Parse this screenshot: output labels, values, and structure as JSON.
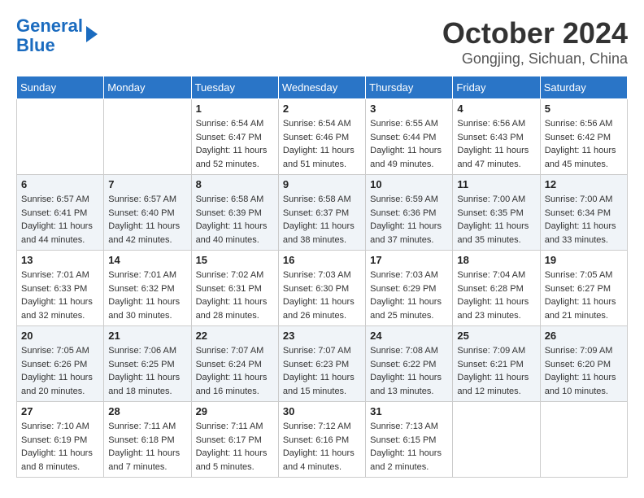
{
  "logo": {
    "line1": "General",
    "line2": "Blue"
  },
  "title": "October 2024",
  "location": "Gongjing, Sichuan, China",
  "days_of_week": [
    "Sunday",
    "Monday",
    "Tuesday",
    "Wednesday",
    "Thursday",
    "Friday",
    "Saturday"
  ],
  "weeks": [
    [
      {
        "day": "",
        "sunrise": "",
        "sunset": "",
        "daylight": ""
      },
      {
        "day": "",
        "sunrise": "",
        "sunset": "",
        "daylight": ""
      },
      {
        "day": "1",
        "sunrise": "Sunrise: 6:54 AM",
        "sunset": "Sunset: 6:47 PM",
        "daylight": "Daylight: 11 hours and 52 minutes."
      },
      {
        "day": "2",
        "sunrise": "Sunrise: 6:54 AM",
        "sunset": "Sunset: 6:46 PM",
        "daylight": "Daylight: 11 hours and 51 minutes."
      },
      {
        "day": "3",
        "sunrise": "Sunrise: 6:55 AM",
        "sunset": "Sunset: 6:44 PM",
        "daylight": "Daylight: 11 hours and 49 minutes."
      },
      {
        "day": "4",
        "sunrise": "Sunrise: 6:56 AM",
        "sunset": "Sunset: 6:43 PM",
        "daylight": "Daylight: 11 hours and 47 minutes."
      },
      {
        "day": "5",
        "sunrise": "Sunrise: 6:56 AM",
        "sunset": "Sunset: 6:42 PM",
        "daylight": "Daylight: 11 hours and 45 minutes."
      }
    ],
    [
      {
        "day": "6",
        "sunrise": "Sunrise: 6:57 AM",
        "sunset": "Sunset: 6:41 PM",
        "daylight": "Daylight: 11 hours and 44 minutes."
      },
      {
        "day": "7",
        "sunrise": "Sunrise: 6:57 AM",
        "sunset": "Sunset: 6:40 PM",
        "daylight": "Daylight: 11 hours and 42 minutes."
      },
      {
        "day": "8",
        "sunrise": "Sunrise: 6:58 AM",
        "sunset": "Sunset: 6:39 PM",
        "daylight": "Daylight: 11 hours and 40 minutes."
      },
      {
        "day": "9",
        "sunrise": "Sunrise: 6:58 AM",
        "sunset": "Sunset: 6:37 PM",
        "daylight": "Daylight: 11 hours and 38 minutes."
      },
      {
        "day": "10",
        "sunrise": "Sunrise: 6:59 AM",
        "sunset": "Sunset: 6:36 PM",
        "daylight": "Daylight: 11 hours and 37 minutes."
      },
      {
        "day": "11",
        "sunrise": "Sunrise: 7:00 AM",
        "sunset": "Sunset: 6:35 PM",
        "daylight": "Daylight: 11 hours and 35 minutes."
      },
      {
        "day": "12",
        "sunrise": "Sunrise: 7:00 AM",
        "sunset": "Sunset: 6:34 PM",
        "daylight": "Daylight: 11 hours and 33 minutes."
      }
    ],
    [
      {
        "day": "13",
        "sunrise": "Sunrise: 7:01 AM",
        "sunset": "Sunset: 6:33 PM",
        "daylight": "Daylight: 11 hours and 32 minutes."
      },
      {
        "day": "14",
        "sunrise": "Sunrise: 7:01 AM",
        "sunset": "Sunset: 6:32 PM",
        "daylight": "Daylight: 11 hours and 30 minutes."
      },
      {
        "day": "15",
        "sunrise": "Sunrise: 7:02 AM",
        "sunset": "Sunset: 6:31 PM",
        "daylight": "Daylight: 11 hours and 28 minutes."
      },
      {
        "day": "16",
        "sunrise": "Sunrise: 7:03 AM",
        "sunset": "Sunset: 6:30 PM",
        "daylight": "Daylight: 11 hours and 26 minutes."
      },
      {
        "day": "17",
        "sunrise": "Sunrise: 7:03 AM",
        "sunset": "Sunset: 6:29 PM",
        "daylight": "Daylight: 11 hours and 25 minutes."
      },
      {
        "day": "18",
        "sunrise": "Sunrise: 7:04 AM",
        "sunset": "Sunset: 6:28 PM",
        "daylight": "Daylight: 11 hours and 23 minutes."
      },
      {
        "day": "19",
        "sunrise": "Sunrise: 7:05 AM",
        "sunset": "Sunset: 6:27 PM",
        "daylight": "Daylight: 11 hours and 21 minutes."
      }
    ],
    [
      {
        "day": "20",
        "sunrise": "Sunrise: 7:05 AM",
        "sunset": "Sunset: 6:26 PM",
        "daylight": "Daylight: 11 hours and 20 minutes."
      },
      {
        "day": "21",
        "sunrise": "Sunrise: 7:06 AM",
        "sunset": "Sunset: 6:25 PM",
        "daylight": "Daylight: 11 hours and 18 minutes."
      },
      {
        "day": "22",
        "sunrise": "Sunrise: 7:07 AM",
        "sunset": "Sunset: 6:24 PM",
        "daylight": "Daylight: 11 hours and 16 minutes."
      },
      {
        "day": "23",
        "sunrise": "Sunrise: 7:07 AM",
        "sunset": "Sunset: 6:23 PM",
        "daylight": "Daylight: 11 hours and 15 minutes."
      },
      {
        "day": "24",
        "sunrise": "Sunrise: 7:08 AM",
        "sunset": "Sunset: 6:22 PM",
        "daylight": "Daylight: 11 hours and 13 minutes."
      },
      {
        "day": "25",
        "sunrise": "Sunrise: 7:09 AM",
        "sunset": "Sunset: 6:21 PM",
        "daylight": "Daylight: 11 hours and 12 minutes."
      },
      {
        "day": "26",
        "sunrise": "Sunrise: 7:09 AM",
        "sunset": "Sunset: 6:20 PM",
        "daylight": "Daylight: 11 hours and 10 minutes."
      }
    ],
    [
      {
        "day": "27",
        "sunrise": "Sunrise: 7:10 AM",
        "sunset": "Sunset: 6:19 PM",
        "daylight": "Daylight: 11 hours and 8 minutes."
      },
      {
        "day": "28",
        "sunrise": "Sunrise: 7:11 AM",
        "sunset": "Sunset: 6:18 PM",
        "daylight": "Daylight: 11 hours and 7 minutes."
      },
      {
        "day": "29",
        "sunrise": "Sunrise: 7:11 AM",
        "sunset": "Sunset: 6:17 PM",
        "daylight": "Daylight: 11 hours and 5 minutes."
      },
      {
        "day": "30",
        "sunrise": "Sunrise: 7:12 AM",
        "sunset": "Sunset: 6:16 PM",
        "daylight": "Daylight: 11 hours and 4 minutes."
      },
      {
        "day": "31",
        "sunrise": "Sunrise: 7:13 AM",
        "sunset": "Sunset: 6:15 PM",
        "daylight": "Daylight: 11 hours and 2 minutes."
      },
      {
        "day": "",
        "sunrise": "",
        "sunset": "",
        "daylight": ""
      },
      {
        "day": "",
        "sunrise": "",
        "sunset": "",
        "daylight": ""
      }
    ]
  ]
}
